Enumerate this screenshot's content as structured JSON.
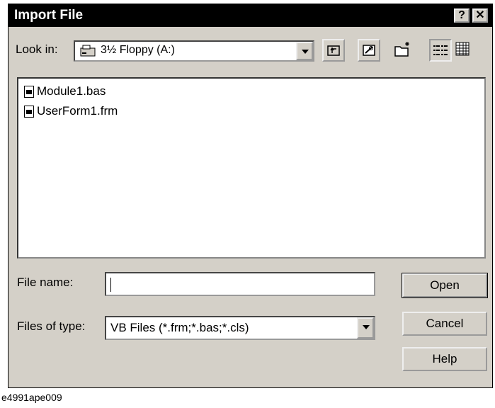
{
  "dialog": {
    "title": "Import File",
    "help_button": "?",
    "close_button": "✕"
  },
  "toolbar": {
    "look_in_label": "Look in:",
    "look_in_value": "3½ Floppy (A:)"
  },
  "files": [
    {
      "name": "Module1.bas"
    },
    {
      "name": "UserForm1.frm"
    }
  ],
  "form": {
    "file_name_label": "File name:",
    "file_name_value": "",
    "files_of_type_label": "Files of type:",
    "files_of_type_value": "VB Files (*.frm;*.bas;*.cls)"
  },
  "buttons": {
    "open": "Open",
    "cancel": "Cancel",
    "help": "Help"
  },
  "caption": "e4991ape009"
}
